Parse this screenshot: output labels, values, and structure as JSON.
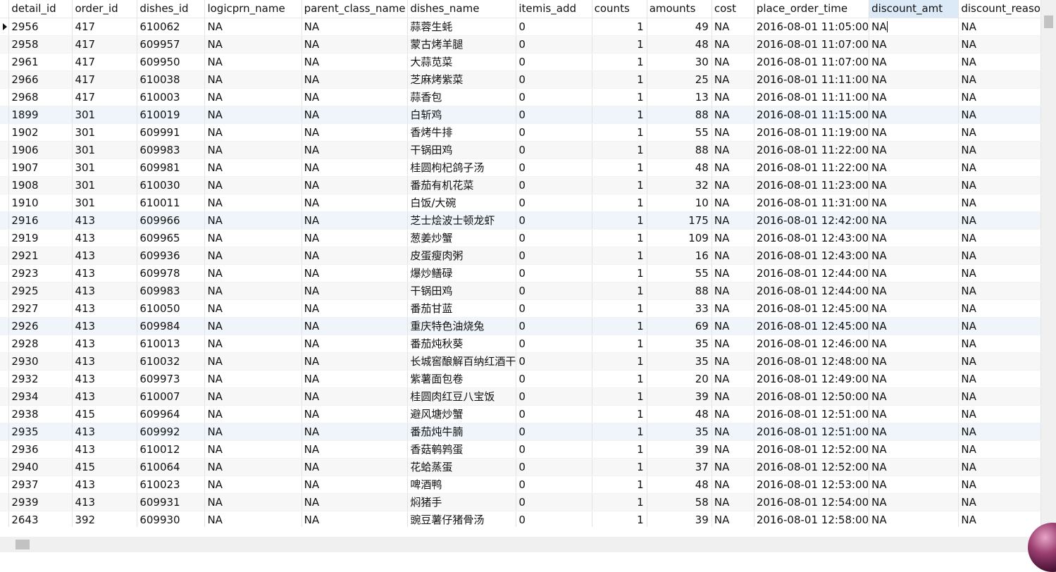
{
  "columns": [
    "detail_id",
    "order_id",
    "dishes_id",
    "logicprn_name",
    "parent_class_name",
    "dishes_name",
    "itemis_add",
    "counts",
    "amounts",
    "cost",
    "place_order_time",
    "discount_amt",
    "discount_reaso"
  ],
  "active_column": "discount_amt",
  "rows": [
    [
      "2956",
      "417",
      "610062",
      "NA",
      "NA",
      "蒜蓉生蚝",
      "0",
      "1",
      "49",
      "NA",
      "2016-08-01 11:05:00",
      "NA",
      "NA"
    ],
    [
      "2958",
      "417",
      "609957",
      "NA",
      "NA",
      "蒙古烤羊腿",
      "0",
      "1",
      "48",
      "NA",
      "2016-08-01 11:07:00",
      "NA",
      "NA"
    ],
    [
      "2961",
      "417",
      "609950",
      "NA",
      "NA",
      "大蒜苋菜",
      "0",
      "1",
      "30",
      "NA",
      "2016-08-01 11:07:00",
      "NA",
      "NA"
    ],
    [
      "2966",
      "417",
      "610038",
      "NA",
      "NA",
      "芝麻烤紫菜",
      "0",
      "1",
      "25",
      "NA",
      "2016-08-01 11:11:00",
      "NA",
      "NA"
    ],
    [
      "2968",
      "417",
      "610003",
      "NA",
      "NA",
      "蒜香包",
      "0",
      "1",
      "13",
      "NA",
      "2016-08-01 11:11:00",
      "NA",
      "NA"
    ],
    [
      "1899",
      "301",
      "610019",
      "NA",
      "NA",
      "白斩鸡",
      "0",
      "1",
      "88",
      "NA",
      "2016-08-01 11:15:00",
      "NA",
      "NA"
    ],
    [
      "1902",
      "301",
      "609991",
      "NA",
      "NA",
      "香烤牛排",
      "0",
      "1",
      "55",
      "NA",
      "2016-08-01 11:19:00",
      "NA",
      "NA"
    ],
    [
      "1906",
      "301",
      "609983",
      "NA",
      "NA",
      "干锅田鸡",
      "0",
      "1",
      "88",
      "NA",
      "2016-08-01 11:22:00",
      "NA",
      "NA"
    ],
    [
      "1907",
      "301",
      "609981",
      "NA",
      "NA",
      "桂圆枸杞鸽子汤",
      "0",
      "1",
      "48",
      "NA",
      "2016-08-01 11:22:00",
      "NA",
      "NA"
    ],
    [
      "1908",
      "301",
      "610030",
      "NA",
      "NA",
      "番茄有机花菜",
      "0",
      "1",
      "32",
      "NA",
      "2016-08-01 11:23:00",
      "NA",
      "NA"
    ],
    [
      "1910",
      "301",
      "610011",
      "NA",
      "NA",
      "白饭/大碗",
      "0",
      "1",
      "10",
      "NA",
      "2016-08-01 11:31:00",
      "NA",
      "NA"
    ],
    [
      "2916",
      "413",
      "609966",
      "NA",
      "NA",
      "芝士烩波士顿龙虾",
      "0",
      "1",
      "175",
      "NA",
      "2016-08-01 12:42:00",
      "NA",
      "NA"
    ],
    [
      "2919",
      "413",
      "609965",
      "NA",
      "NA",
      "葱姜炒蟹",
      "0",
      "1",
      "109",
      "NA",
      "2016-08-01 12:43:00",
      "NA",
      "NA"
    ],
    [
      "2921",
      "413",
      "609936",
      "NA",
      "NA",
      "皮蛋瘦肉粥",
      "0",
      "1",
      "16",
      "NA",
      "2016-08-01 12:43:00",
      "NA",
      "NA"
    ],
    [
      "2923",
      "413",
      "609978",
      "NA",
      "NA",
      "爆炒鳝碌",
      "0",
      "1",
      "55",
      "NA",
      "2016-08-01 12:44:00",
      "NA",
      "NA"
    ],
    [
      "2925",
      "413",
      "609983",
      "NA",
      "NA",
      "干锅田鸡",
      "0",
      "1",
      "88",
      "NA",
      "2016-08-01 12:44:00",
      "NA",
      "NA"
    ],
    [
      "2927",
      "413",
      "610050",
      "NA",
      "NA",
      "番茄甘蓝",
      "0",
      "1",
      "33",
      "NA",
      "2016-08-01 12:45:00",
      "NA",
      "NA"
    ],
    [
      "2926",
      "413",
      "609984",
      "NA",
      "NA",
      "重庆特色油烧兔",
      "0",
      "1",
      "69",
      "NA",
      "2016-08-01 12:45:00",
      "NA",
      "NA"
    ],
    [
      "2928",
      "413",
      "610013",
      "NA",
      "NA",
      "番茄炖秋葵",
      "0",
      "1",
      "35",
      "NA",
      "2016-08-01 12:46:00",
      "NA",
      "NA"
    ],
    [
      "2930",
      "413",
      "610032",
      "NA",
      "NA",
      "长城窖酿解百纳红酒干",
      "0",
      "1",
      "35",
      "NA",
      "2016-08-01 12:48:00",
      "NA",
      "NA"
    ],
    [
      "2932",
      "413",
      "609973",
      "NA",
      "NA",
      "紫薯面包卷",
      "0",
      "1",
      "20",
      "NA",
      "2016-08-01 12:49:00",
      "NA",
      "NA"
    ],
    [
      "2934",
      "413",
      "610007",
      "NA",
      "NA",
      "桂圆肉红豆八宝饭",
      "0",
      "1",
      "39",
      "NA",
      "2016-08-01 12:50:00",
      "NA",
      "NA"
    ],
    [
      "2938",
      "415",
      "609964",
      "NA",
      "NA",
      "避风塘炒蟹",
      "0",
      "1",
      "48",
      "NA",
      "2016-08-01 12:51:00",
      "NA",
      "NA"
    ],
    [
      "2935",
      "413",
      "609992",
      "NA",
      "NA",
      "番茄炖牛腩",
      "0",
      "1",
      "35",
      "NA",
      "2016-08-01 12:51:00",
      "NA",
      "NA"
    ],
    [
      "2936",
      "413",
      "610012",
      "NA",
      "NA",
      "香菇鹌鹑蛋",
      "0",
      "1",
      "39",
      "NA",
      "2016-08-01 12:52:00",
      "NA",
      "NA"
    ],
    [
      "2940",
      "415",
      "610064",
      "NA",
      "NA",
      "花蛤蒸蛋",
      "0",
      "1",
      "37",
      "NA",
      "2016-08-01 12:52:00",
      "NA",
      "NA"
    ],
    [
      "2937",
      "413",
      "610023",
      "NA",
      "NA",
      "啤酒鸭",
      "0",
      "1",
      "48",
      "NA",
      "2016-08-01 12:53:00",
      "NA",
      "NA"
    ],
    [
      "2939",
      "413",
      "609931",
      "NA",
      "NA",
      "焖猪手",
      "0",
      "1",
      "58",
      "NA",
      "2016-08-01 12:54:00",
      "NA",
      "NA"
    ],
    [
      "2643",
      "392",
      "609930",
      "NA",
      "NA",
      "豌豆薯仔猪骨汤",
      "0",
      "1",
      "39",
      "NA",
      "2016-08-01 12:58:00",
      "NA",
      "NA"
    ]
  ],
  "icons": {
    "row_pointer": "row-pointer-icon",
    "avatar": "avatar-icon"
  }
}
